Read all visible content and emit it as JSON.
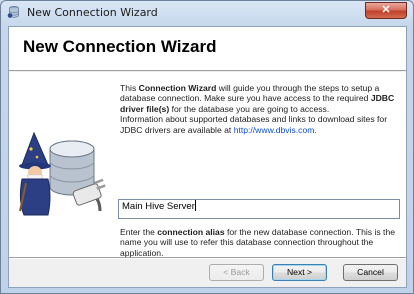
{
  "window": {
    "title": "New Connection Wizard",
    "close_label": "✕"
  },
  "header": {
    "title": "New Connection Wizard"
  },
  "intro": {
    "p1_pre": "This ",
    "p1_bold1": "Connection Wizard",
    "p1_mid": " will guide you through the steps to setup a database connection. Make sure you have access to the required ",
    "p1_bold2": "JDBC driver file(s)",
    "p1_post": " for the database you are going to access.",
    "p2_pre": "Information about supported databases and links to download sites for JDBC drivers are available at ",
    "p2_link": "http://www.dbvis.com",
    "p2_post": "."
  },
  "alias": {
    "value": "Main Hive Server",
    "help_pre": "Enter the ",
    "help_bold": "connection alias",
    "help_post": " for the new database connection. This is the name you will use to refer this database connection throughout the application."
  },
  "buttons": {
    "back": "< Back",
    "next": "Next >",
    "cancel": "Cancel"
  },
  "icons": {
    "app": "database-wizard-icon",
    "illustration": "database-wizard-plug-icon"
  },
  "colors": {
    "link": "#0b4fd6",
    "close": "#c0412c"
  }
}
